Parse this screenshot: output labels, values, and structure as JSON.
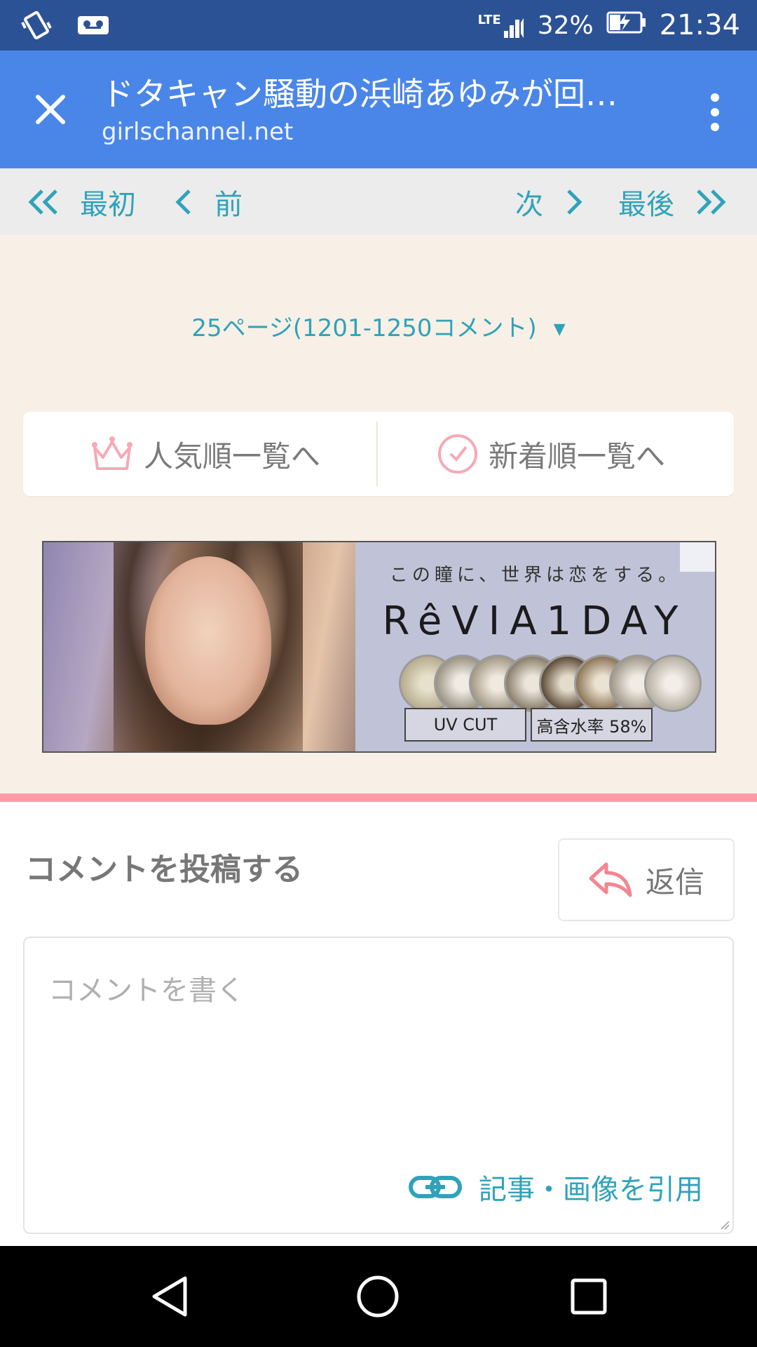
{
  "status_bar": {
    "network": "LTE",
    "battery": "32%",
    "time": "21:34"
  },
  "toolbar": {
    "title": "ドタキャン騒動の浜崎あゆみが回…",
    "url": "girlschannel.net"
  },
  "pager": {
    "first": "最初",
    "prev": "前",
    "next": "次",
    "last": "最後"
  },
  "page_select": {
    "label": "25ページ(1201-1250コメント)",
    "arrow": "▼"
  },
  "sort": {
    "popular": "人気順一覧へ",
    "newest": "新着順一覧へ"
  },
  "ad": {
    "tagline": "この瞳に、世界は恋をする。",
    "brand": "RêVIA1DAY",
    "tag_uv": "UV CUT",
    "tag_water": "高含水率 58%"
  },
  "post": {
    "title": "コメントを投稿する",
    "reply": "返信",
    "placeholder": "コメントを書く",
    "quote": "記事・画像を引用"
  },
  "colors": {
    "status_bar": "#2c5296",
    "toolbar": "#4a86e8",
    "accent_teal": "#2fa3ba",
    "accent_pink": "#ff9aa7",
    "background": "#f8f0e6"
  }
}
